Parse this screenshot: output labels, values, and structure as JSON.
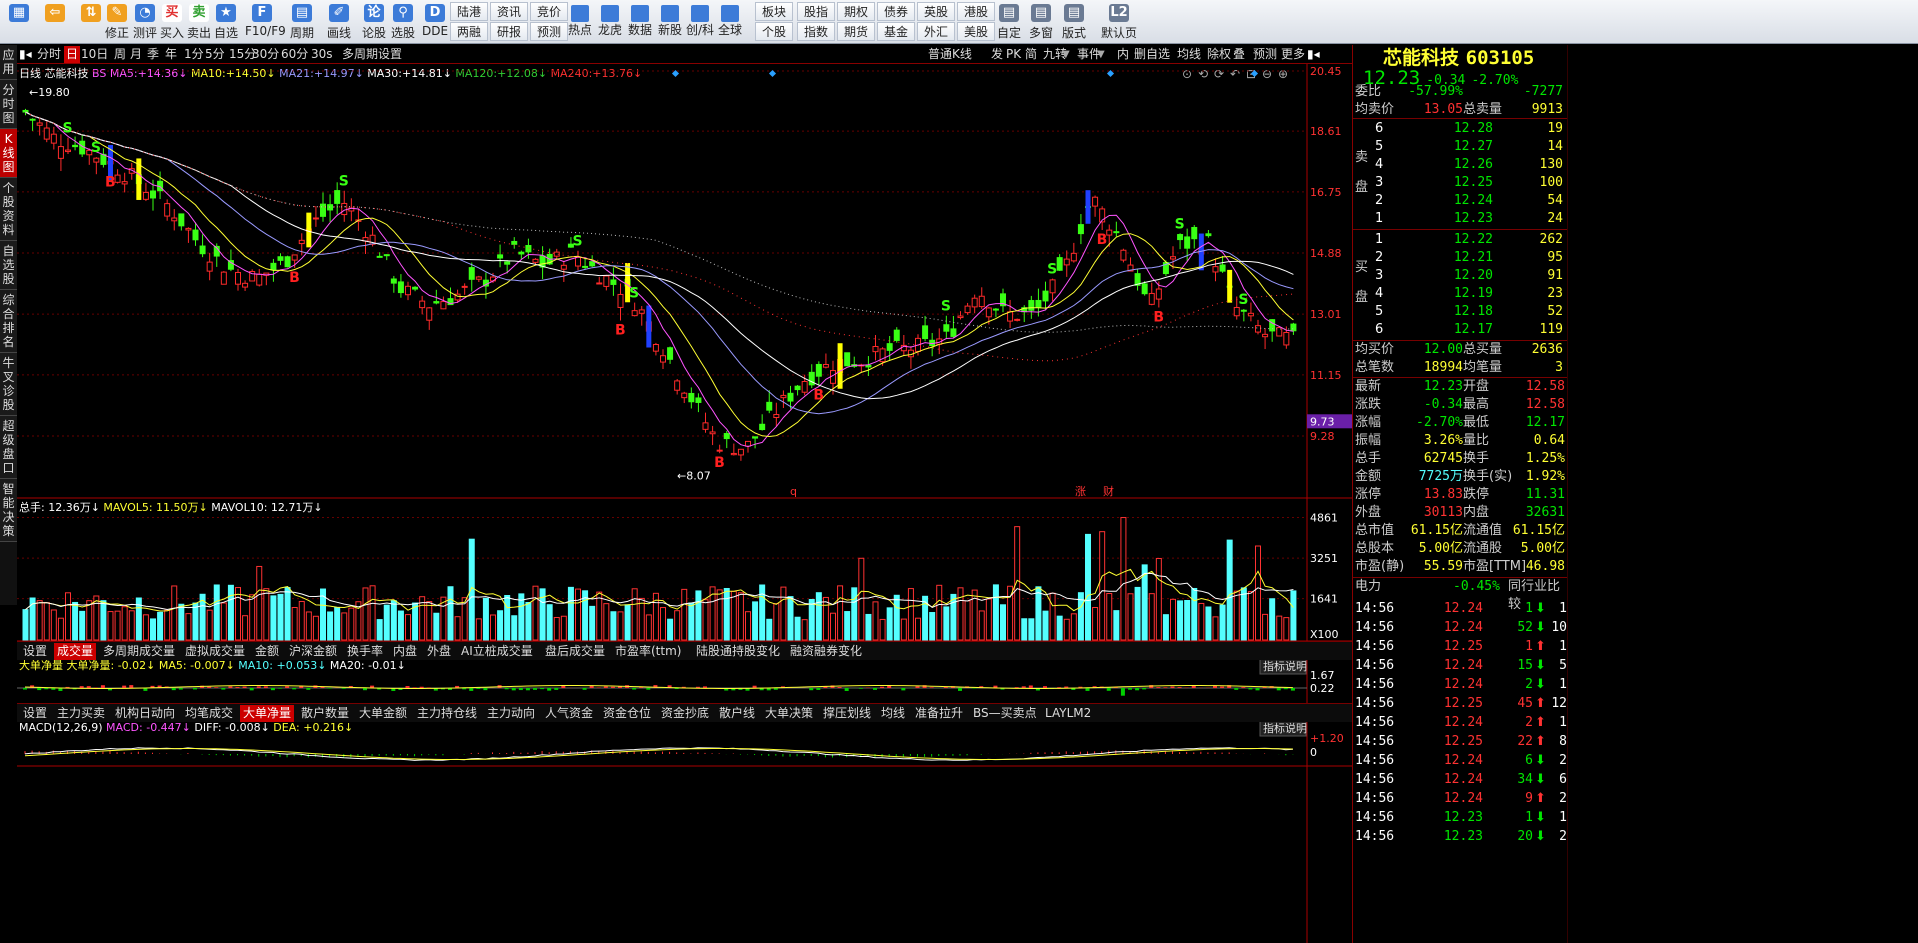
{
  "toolbar": {
    "big_buttons": [
      {
        "label": "",
        "icon": "layout-icon"
      },
      {
        "label": "",
        "icon": "back-arrow-icon"
      },
      {
        "label": "",
        "icon": "up-down-icon"
      },
      {
        "label": "修正",
        "icon": "fix-icon"
      },
      {
        "label": "测评",
        "icon": "clock-icon"
      },
      {
        "label": "买入",
        "icon": "buy-icon"
      },
      {
        "label": "卖出",
        "icon": "sell-icon"
      },
      {
        "label": "自选",
        "icon": "watchlist-icon"
      },
      {
        "label": "F10/F9",
        "icon": "f10-icon"
      },
      {
        "label": "周期",
        "icon": "period-icon"
      },
      {
        "label": "画线",
        "icon": "draw-icon"
      },
      {
        "label": "论股",
        "icon": "discuss-icon"
      },
      {
        "label": "选股",
        "icon": "select-icon"
      },
      {
        "label": "DDE",
        "icon": "dde-icon"
      }
    ],
    "small_buttons_row1": [
      "陆港",
      "资讯",
      "竞价",
      "热点",
      "龙虎",
      "数据",
      "新股",
      "创/科",
      "全球",
      "板块",
      "股指",
      "期权",
      "债券",
      "英股",
      "港股"
    ],
    "small_buttons_row2": [
      "两融",
      "研报",
      "预测",
      "",
      "",
      "",
      "",
      "",
      "",
      "个股",
      "指数",
      "期货",
      "基金",
      "外汇",
      "美股"
    ],
    "right_buttons": [
      {
        "label": "自定",
        "icon": "custom-icon"
      },
      {
        "label": "多窗",
        "icon": "multiwindow-icon"
      },
      {
        "label": "版式",
        "icon": "layout2-icon"
      },
      {
        "label": "默认页",
        "icon": "l2-icon"
      }
    ]
  },
  "left_tabs": [
    "应用",
    "分时图",
    "K线图",
    "个股资料",
    "自选股",
    "综合排名",
    "牛叉诊股",
    "超级盘口",
    "智能决策"
  ],
  "period_bar": {
    "items": [
      "分时",
      "日",
      "10日",
      "周",
      "月",
      "季",
      "年",
      "1分",
      "5分",
      "15分",
      "30分",
      "60分",
      "30s",
      "多周期",
      "设置"
    ],
    "selected": "日",
    "right_items": [
      "普通K线",
      "发",
      "PK",
      "简",
      "九转",
      "事件",
      "内",
      "删自选",
      "均线",
      "除权",
      "叠",
      "预测",
      "更多"
    ]
  },
  "main_chart": {
    "legend_prefix": "日线",
    "stock_name": "芯能科技",
    "ma_items": [
      {
        "label": "BS",
        "value": "",
        "color": "#ff55ff"
      },
      {
        "label": "MA5:",
        "value": "+14.36",
        "color": "#ff55ff"
      },
      {
        "label": "MA10:",
        "value": "+14.50",
        "color": "#ffff33"
      },
      {
        "label": "MA21:",
        "value": "+14.97",
        "color": "#9a9aff"
      },
      {
        "label": "MA30:",
        "value": "+14.81",
        "color": "#ffffff"
      },
      {
        "label": "MA120:",
        "value": "+12.08",
        "color": "#33cc33"
      },
      {
        "label": "MA240:",
        "value": "+13.76",
        "color": "#ff3232"
      }
    ],
    "y_ticks": [
      "20.45",
      "18.61",
      "16.75",
      "14.88",
      "13.01",
      "11.15",
      "9.28"
    ],
    "current_price_tag": "9.73",
    "high_label": "19.80",
    "low_label": "8.07",
    "event_labels": [
      "q",
      "涨",
      "财"
    ]
  },
  "volume_chart": {
    "legend": [
      {
        "label": "总手:",
        "value": "12.36万",
        "color": "#ffffff"
      },
      {
        "label": "MAVOL5:",
        "value": "11.50万",
        "color": "#ffff33"
      },
      {
        "label": "MAVOL10:",
        "value": "12.71万",
        "color": "#ffffff"
      }
    ],
    "y_ticks": [
      "4861",
      "3251",
      "1641"
    ],
    "unit": "X100"
  },
  "indicator_tabs_1": [
    "设置",
    "成交量",
    "多周期成交量",
    "虚拟成交量",
    "金额",
    "沪深金额",
    "换手率",
    "内盘",
    "外盘",
    "AI立桩成交量",
    "盘后成交量",
    "市盈率(ttm)",
    "陆股通持股变化",
    "融资融券变化"
  ],
  "indicator_tabs_1_selected": "成交量",
  "net_chart": {
    "title": "大单净量",
    "legend": [
      {
        "label": "大单净量:",
        "value": "-0.02",
        "color": "#ffff33"
      },
      {
        "label": "MA5:",
        "value": "-0.007",
        "color": "#ffff33"
      },
      {
        "label": "MA10:",
        "value": "+0.053",
        "color": "#54ffff"
      },
      {
        "label": "MA20:",
        "value": "-0.01",
        "color": "#ffffff"
      }
    ],
    "y_ticks": [
      "1.67",
      "0.22"
    ],
    "explain": "指标说明"
  },
  "indicator_tabs_2": [
    "设置",
    "主力买卖",
    "机构日动向",
    "均笔成交",
    "大单净量",
    "散户数量",
    "大单金额",
    "主力持仓线",
    "主力动向",
    "人气资金",
    "资金仓位",
    "资金抄底",
    "散户线",
    "大单决策",
    "撑压划线",
    "均线",
    "准备拉升",
    "BS—买卖点",
    "LAYLM2"
  ],
  "indicator_tabs_2_selected": "大单净量",
  "macd_chart": {
    "title": "MACD(12,26,9)",
    "legend": [
      {
        "label": "MACD:",
        "value": "-0.447",
        "color": "#ff55ff"
      },
      {
        "label": "DIFF:",
        "value": "-0.008",
        "color": "#ffffff"
      },
      {
        "label": "DEA:",
        "value": "+0.216",
        "color": "#ffff33"
      }
    ],
    "y_ticks": [
      "+1.20",
      "0"
    ],
    "explain": "指标说明"
  },
  "quote": {
    "name": "芯能科技",
    "code": "603105",
    "price": "12.23",
    "change": "-0.34",
    "change_pct": "-2.70%",
    "weibi_label": "委比",
    "weibi": "-57.99%",
    "weicha": "-7277",
    "avg_sell_label": "均卖价",
    "avg_sell": "13.05",
    "total_sell_label": "总卖量",
    "total_sell": "9913",
    "sell_side_label": "卖盘",
    "buy_side_label": "买盘",
    "asks": [
      {
        "level": "6",
        "price": "12.28",
        "vol": "19"
      },
      {
        "level": "5",
        "price": "12.27",
        "vol": "14"
      },
      {
        "level": "4",
        "price": "12.26",
        "vol": "130"
      },
      {
        "level": "3",
        "price": "12.25",
        "vol": "100"
      },
      {
        "level": "2",
        "price": "12.24",
        "vol": "54"
      },
      {
        "level": "1",
        "price": "12.23",
        "vol": "24"
      }
    ],
    "bids": [
      {
        "level": "1",
        "price": "12.22",
        "vol": "262"
      },
      {
        "level": "2",
        "price": "12.21",
        "vol": "95"
      },
      {
        "level": "3",
        "price": "12.20",
        "vol": "91"
      },
      {
        "level": "4",
        "price": "12.19",
        "vol": "23"
      },
      {
        "level": "5",
        "price": "12.18",
        "vol": "52"
      },
      {
        "level": "6",
        "price": "12.17",
        "vol": "119"
      }
    ],
    "avg_buy_label": "均买价",
    "avg_buy": "12.00",
    "total_buy_label": "总买量",
    "total_buy": "2636",
    "trades_label": "总笔数",
    "trades": "18994",
    "avg_per_label": "均笔量",
    "avg_per": "3",
    "stats": [
      {
        "l1": "最新",
        "v1": "12.23",
        "c1": "#00e600",
        "l2": "开盘",
        "v2": "12.58",
        "c2": "#ff3232"
      },
      {
        "l1": "涨跌",
        "v1": "-0.34",
        "c1": "#00e600",
        "l2": "最高",
        "v2": "12.58",
        "c2": "#ff3232"
      },
      {
        "l1": "涨幅",
        "v1": "-2.70%",
        "c1": "#00e600",
        "l2": "最低",
        "v2": "12.17",
        "c2": "#00e600"
      },
      {
        "l1": "振幅",
        "v1": "3.26%",
        "c1": "#ffff33",
        "l2": "量比",
        "v2": "0.64",
        "c2": "#ffff33"
      },
      {
        "l1": "总手",
        "v1": "62745",
        "c1": "#ffff33",
        "l2": "换手",
        "v2": "1.25%",
        "c2": "#ffff33"
      },
      {
        "l1": "金额",
        "v1": "7725万",
        "c1": "#54ffff",
        "l2": "换手(实)",
        "v2": "1.92%",
        "c2": "#ffff33"
      },
      {
        "l1": "涨停",
        "v1": "13.83",
        "c1": "#ff3232",
        "l2": "跌停",
        "v2": "11.31",
        "c2": "#00e600"
      },
      {
        "l1": "外盘",
        "v1": "30113",
        "c1": "#ff3232",
        "l2": "内盘",
        "v2": "32631",
        "c2": "#00e600"
      },
      {
        "l1": "总市值",
        "v1": "61.15亿",
        "c1": "#ffff33",
        "l2": "流通值",
        "v2": "61.15亿",
        "c2": "#ffff33"
      },
      {
        "l1": "总股本",
        "v1": "5.00亿",
        "c1": "#ffff33",
        "l2": "流通股",
        "v2": "5.00亿",
        "c2": "#ffff33"
      },
      {
        "l1": "市盈(静)",
        "v1": "55.59",
        "c1": "#ffff33",
        "l2": "市盈[TTM]",
        "v2": "46.98",
        "c2": "#ffff33"
      }
    ],
    "power_label": "电力",
    "power_value": "-0.45%",
    "industry_compare": "同行业比较",
    "ticks": [
      {
        "time": "14:56",
        "price": "12.24",
        "vol": "1",
        "dir": "down",
        "cnt": "1"
      },
      {
        "time": "14:56",
        "price": "12.24",
        "vol": "52",
        "dir": "down",
        "cnt": "10"
      },
      {
        "time": "14:56",
        "price": "12.25",
        "vol": "1",
        "dir": "up",
        "cnt": "1"
      },
      {
        "time": "14:56",
        "price": "12.24",
        "vol": "15",
        "dir": "down",
        "cnt": "5"
      },
      {
        "time": "14:56",
        "price": "12.24",
        "vol": "2",
        "dir": "down",
        "cnt": "1"
      },
      {
        "time": "14:56",
        "price": "12.25",
        "vol": "45",
        "dir": "up",
        "cnt": "12"
      },
      {
        "time": "14:56",
        "price": "12.24",
        "vol": "2",
        "dir": "up",
        "cnt": "1"
      },
      {
        "time": "14:56",
        "price": "12.25",
        "vol": "22",
        "dir": "up",
        "cnt": "8"
      },
      {
        "time": "14:56",
        "price": "12.24",
        "vol": "6",
        "dir": "down",
        "cnt": "2"
      },
      {
        "time": "14:56",
        "price": "12.24",
        "vol": "34",
        "dir": "down",
        "cnt": "6"
      },
      {
        "time": "14:56",
        "price": "12.24",
        "vol": "9",
        "dir": "up",
        "cnt": "2"
      },
      {
        "time": "14:56",
        "price": "12.23",
        "vol": "1",
        "dir": "down",
        "cnt": "1"
      },
      {
        "time": "14:56",
        "price": "12.23",
        "vol": "20",
        "dir": "down",
        "cnt": "2"
      }
    ]
  },
  "chart_data": {
    "type": "candlestick",
    "ohlc_sampled_close": [
      19.2,
      18.4,
      18.1,
      17.6,
      17.0,
      16.3,
      15.2,
      14.4,
      14.1,
      14.6,
      15.8,
      16.5,
      15.4,
      13.8,
      13.3,
      13.6,
      14.1,
      14.9,
      14.5,
      14.9,
      14.2,
      13.6,
      12.2,
      10.6,
      9.1,
      8.9,
      10.0,
      11.0,
      11.5,
      11.6,
      11.9,
      12.0,
      12.3,
      13.8,
      13.0,
      13.0,
      14.2,
      16.6,
      15.3,
      13.2,
      15.1,
      15.3,
      13.2,
      12.4,
      12.23
    ],
    "ylim": [
      8.07,
      20.45
    ]
  }
}
